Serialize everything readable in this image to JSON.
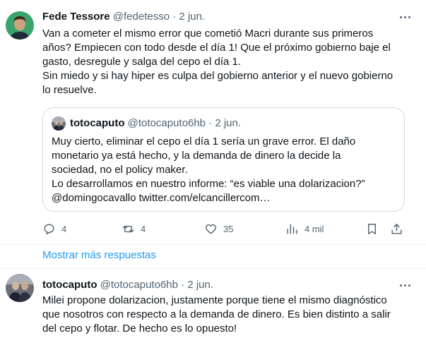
{
  "tweet1": {
    "display_name": "Fede Tessore",
    "handle": "@fedetesso",
    "separator": "·",
    "date": "2 jun.",
    "text_lines": [
      "Van a cometer el mismo error que cometió Macri durante sus primeros",
      "años? Empiecen con todo desde el día 1! Que el próximo gobierno baje el",
      "gasto, desregule y salga del cepo el día 1.",
      "Sin miedo y si hay hiper es culpa del gobierno anterior y el nuevo gobierno",
      "lo resuelve."
    ],
    "quote": {
      "display_name": "totocaputo",
      "handle": "@totocaputo6hb",
      "separator": "·",
      "date": "2 jun.",
      "text_lines": [
        "Muy cierto, eliminar el cepo el día 1 sería un grave error. El daño",
        "monetario ya está hecho, y la demanda de dinero la decide la",
        "sociedad, no el policy maker.",
        "Lo desarrollamos en nuestro informe: “es viable una dolarizacion?”",
        "@domingocavallo twitter.com/elcancillercom…"
      ]
    },
    "actions": {
      "replies": "4",
      "retweets": "4",
      "likes": "35",
      "views": "4 mil"
    }
  },
  "show_more_label": "Mostrar más respuestas",
  "tweet2": {
    "display_name": "totocaputo",
    "handle": "@totocaputo6hb",
    "separator": "·",
    "date": "2 jun.",
    "text_lines": [
      "Milei propone dolarizacion, justamente porque tiene el mismo diagnóstico",
      "que nosotros con respecto a la demanda de dinero. Es bien distinto a salir",
      "del cepo y flotar. De hecho es lo opuesto!"
    ]
  },
  "colors": {
    "text": "#0f1419",
    "secondary": "#536471",
    "link": "#1d9bf0",
    "border": "#cfd9de"
  },
  "icons": [
    "more-icon",
    "reply-icon",
    "retweet-icon",
    "like-icon",
    "views-icon",
    "bookmark-icon",
    "share-icon"
  ]
}
